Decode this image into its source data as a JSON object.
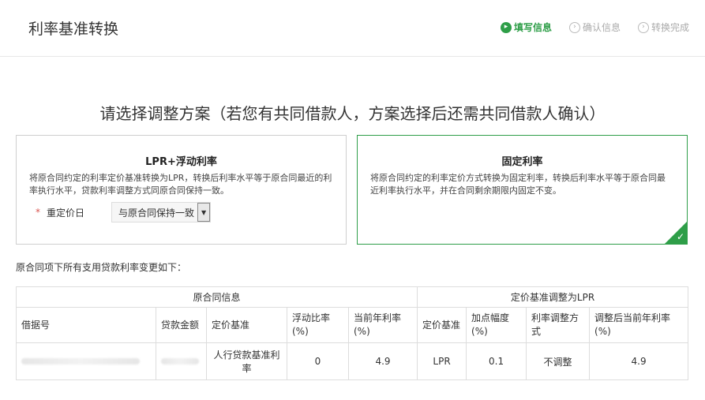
{
  "header": {
    "title": "利率基准转换",
    "steps": [
      {
        "label": "填写信息",
        "state": "active"
      },
      {
        "label": "确认信息",
        "state": "pending"
      },
      {
        "label": "转换完成",
        "state": "pending"
      }
    ]
  },
  "heading": "请选择调整方案（若您有共同借款人，方案选择后还需共同借款人确认）",
  "options": {
    "lpr": {
      "title": "LPR+浮动利率",
      "desc": "将原合同约定的利率定价基准转换为LPR，转换后利率水平等于原合同最近的利率执行水平，贷款利率调整方式同原合同保持一致。",
      "required_mark": "*",
      "reprice_label": "重定价日",
      "reprice_value": "与原合同保持一致"
    },
    "fixed": {
      "title": "固定利率",
      "desc": "将原合同约定的利率定价方式转换为固定利率，转换后利率水平等于原合同最近利率执行水平，并在合同剩余期限内固定不变。",
      "selected": true,
      "check": "✓"
    }
  },
  "table": {
    "intro": "原合同项下所有支用贷款利率变更如下：",
    "group_original": "原合同信息",
    "group_lpr": "定价基准调整为LPR",
    "columns": [
      "借据号",
      "贷款金额",
      "定价基准",
      "浮动比率(%)",
      "当前年利率(%)",
      "定价基准",
      "加点幅度(%)",
      "利率调整方式",
      "调整后当前年利率(%)"
    ],
    "row": {
      "base": "人行贷款基准利率",
      "float_ratio": "0",
      "current_rate": "4.9",
      "new_base": "LPR",
      "bp": "0.1",
      "adjust_mode": "不调整",
      "new_rate": "4.9"
    }
  },
  "colors": {
    "accent_green": "#2e9e48",
    "required_red": "#d9534f",
    "border": "#dddddd"
  }
}
